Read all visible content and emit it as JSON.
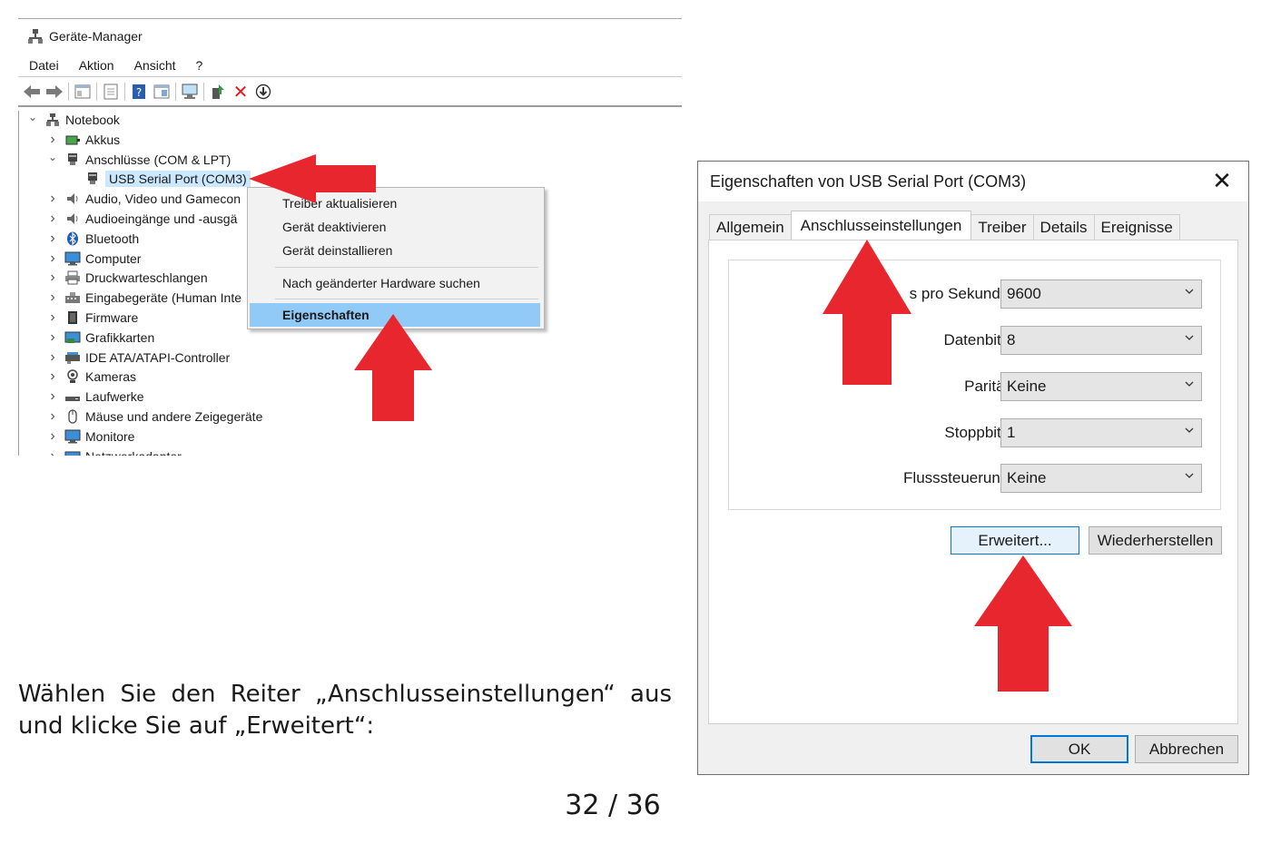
{
  "device_manager": {
    "title": "Geräte-Manager",
    "menu": [
      "Datei",
      "Aktion",
      "Ansicht",
      "?"
    ],
    "tree": [
      {
        "label": "Notebook",
        "level": 0,
        "chevron": "expanded",
        "icon": "computer-root-icon"
      },
      {
        "label": "Akkus",
        "level": 1,
        "chevron": "collapsed",
        "icon": "battery-icon"
      },
      {
        "label": "Anschlüsse (COM & LPT)",
        "level": 1,
        "chevron": "expanded",
        "icon": "port-icon"
      },
      {
        "label": "USB Serial Port (COM3)",
        "level": 2,
        "chevron": "none",
        "icon": "port-icon",
        "selected": true
      },
      {
        "label": "Audio, Video und Gamecon",
        "level": 1,
        "chevron": "collapsed",
        "icon": "speaker-icon"
      },
      {
        "label": "Audioeingänge und -ausgä",
        "level": 1,
        "chevron": "collapsed",
        "icon": "speaker-icon"
      },
      {
        "label": "Bluetooth",
        "level": 1,
        "chevron": "collapsed",
        "icon": "bluetooth-icon"
      },
      {
        "label": "Computer",
        "level": 1,
        "chevron": "collapsed",
        "icon": "monitor-icon"
      },
      {
        "label": "Druckwarteschlangen",
        "level": 1,
        "chevron": "collapsed",
        "icon": "printer-icon"
      },
      {
        "label": "Eingabegeräte (Human Inte",
        "level": 1,
        "chevron": "collapsed",
        "icon": "keyboard-icon"
      },
      {
        "label": "Firmware",
        "level": 1,
        "chevron": "collapsed",
        "icon": "chip-icon"
      },
      {
        "label": "Grafikkarten",
        "level": 1,
        "chevron": "collapsed",
        "icon": "display-adapter-icon"
      },
      {
        "label": "IDE ATA/ATAPI-Controller",
        "level": 1,
        "chevron": "collapsed",
        "icon": "controller-icon"
      },
      {
        "label": "Kameras",
        "level": 1,
        "chevron": "collapsed",
        "icon": "camera-icon"
      },
      {
        "label": "Laufwerke",
        "level": 1,
        "chevron": "collapsed",
        "icon": "drive-icon"
      },
      {
        "label": "Mäuse und andere Zeigegeräte",
        "level": 1,
        "chevron": "collapsed",
        "icon": "mouse-icon"
      },
      {
        "label": "Monitore",
        "level": 1,
        "chevron": "collapsed",
        "icon": "monitor-icon"
      },
      {
        "label": "Netzwerkadapter",
        "level": 1,
        "chevron": "collapsed",
        "icon": "network-icon"
      }
    ],
    "context_menu": [
      {
        "label": "Treiber aktualisieren"
      },
      {
        "label": "Gerät deaktivieren"
      },
      {
        "label": "Gerät deinstallieren"
      },
      {
        "label": "Nach geänderter Hardware suchen"
      },
      {
        "label": "Eigenschaften",
        "highlighted": true
      }
    ]
  },
  "caption": "Wählen Sie den Reiter „Anschlusseinstellungen“ aus und klicke Sie auf „Erweitert“:",
  "page_number": "32 / 36",
  "dialog": {
    "title": "Eigenschaften von USB Serial Port (COM3)",
    "close_symbol": "✕",
    "tabs": [
      "Allgemein",
      "Anschlusseinstellungen",
      "Treiber",
      "Details",
      "Ereignisse"
    ],
    "active_tab": "Anschlusseinstellungen",
    "fields": [
      {
        "label": "Bits pro Sekunde:",
        "visible_label": "s pro Sekunde:",
        "value": "9600"
      },
      {
        "label": "Datenbits:",
        "value": "8"
      },
      {
        "label": "Parität:",
        "value": "Keine"
      },
      {
        "label": "Stoppbits:",
        "value": "1"
      },
      {
        "label": "Flusssteuerung:",
        "value": "Keine"
      }
    ],
    "advanced_button": "Erweitert...",
    "restore_button": "Wiederherstellen",
    "ok_button": "OK",
    "cancel_button": "Abbrechen"
  },
  "colors": {
    "arrow": "#e8262d",
    "highlight": "#91c9f7",
    "selection": "#cce8ff",
    "focus_border": "#0078d7"
  }
}
